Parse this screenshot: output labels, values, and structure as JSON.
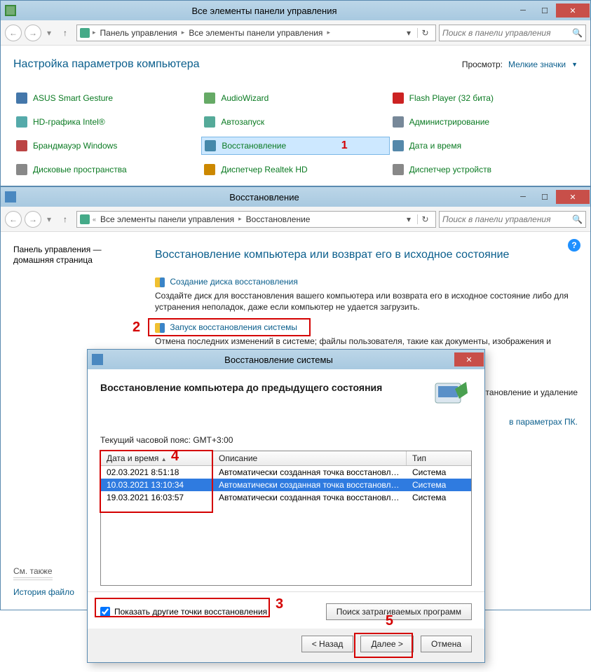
{
  "window1": {
    "title": "Все элементы панели управления",
    "breadcrumb": [
      "Панель управления",
      "Все элементы панели управления"
    ],
    "search_placeholder": "Поиск в панели управления",
    "heading": "Настройка параметров компьютера",
    "view_label": "Просмотр:",
    "view_value": "Мелкие значки",
    "items_col1": [
      "ASUS Smart Gesture",
      "HD-графика Intel®",
      "Брандмауэр Windows",
      "Дисковые пространства"
    ],
    "items_col2": [
      "AudioWizard",
      "Автозапуск",
      "Восстановление",
      "Диспетчер Realtek HD"
    ],
    "items_col3": [
      "Flash Player (32 бита)",
      "Администрирование",
      "Дата и время",
      "Диспетчер устройств"
    ],
    "selected_index": 2,
    "annotation1": "1"
  },
  "window2": {
    "title": "Восстановление",
    "breadcrumb": [
      "Все элементы панели управления",
      "Восстановление"
    ],
    "search_placeholder": "Поиск в панели управления",
    "sidebar_line1": "Панель управления —",
    "sidebar_line2": "домашняя страница",
    "see_also": "См. также",
    "history": "История файло",
    "heading": "Восстановление компьютера или возврат его в исходное состояние",
    "link1": "Создание диска восстановления",
    "text1": "Создайте диск для восстановления вашего компьютера или возврата его в исходное состояние либо для устранения неполадок, даже если компьютер не удается загрузить.",
    "link2": "Запуск восстановления системы",
    "text2": "Отмена последних изменений в системе; файлы пользователя, такие как документы, изображения и музыка, остаются без изменений.",
    "tail1": "становление и удаление",
    "tail2": "в параметрах ПК.",
    "annotation2": "2"
  },
  "modal": {
    "title": "Восстановление системы",
    "subtitle": "Восстановление компьютера до предыдущего состояния",
    "tz": "Текущий часовой пояс: GMT+3:00",
    "columns": {
      "date": "Дата и время",
      "desc": "Описание",
      "type": "Тип"
    },
    "rows": [
      {
        "date": "02.03.2021 8:51:18",
        "desc": "Автоматически созданная точка восстановле…",
        "type": "Система"
      },
      {
        "date": "10.03.2021 13:10:34",
        "desc": "Автоматически созданная точка восстановле…",
        "type": "Система"
      },
      {
        "date": "19.03.2021 16:03:57",
        "desc": "Автоматически созданная точка восстановле…",
        "type": "Система"
      }
    ],
    "selected_row": 1,
    "checkbox": "Показать другие точки восстановления",
    "affected_btn": "Поиск затрагиваемых программ",
    "back_btn": "< Назад",
    "next_btn": "Далее >",
    "cancel_btn": "Отмена",
    "annotation3": "3",
    "annotation4": "4",
    "annotation5": "5"
  }
}
